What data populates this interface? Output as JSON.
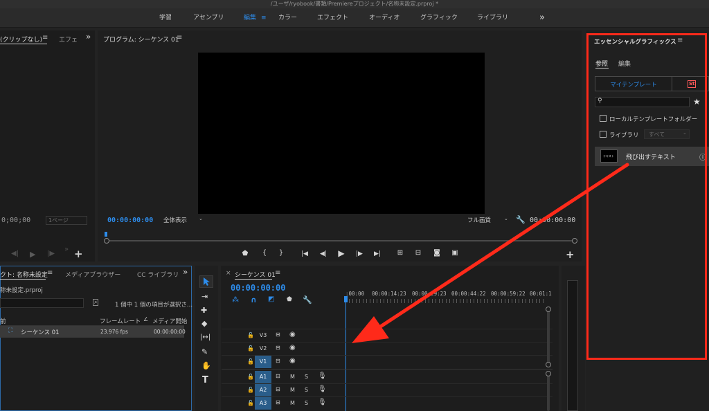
{
  "window": {
    "title": "/ユーザ/ryobook/書類/Premiereプロジェクト/名称未設定.prproj *"
  },
  "workspaces": {
    "items": [
      "学習",
      "アセンブリ",
      "編集",
      "カラー",
      "エフェクト",
      "オーディオ",
      "グラフィック",
      "ライブラリ"
    ],
    "active": "編集",
    "menu_icon": "≡",
    "more": "»"
  },
  "source_panel": {
    "tab_label": "(クリップなし)",
    "menu": "≡",
    "tab2": "エフェ",
    "more": "»",
    "timecode": "0;00;00",
    "page_select": "1ページ"
  },
  "program_monitor": {
    "title": "プログラム: シーケンス 01",
    "menu": "≡",
    "timecode_left": "00:00:00:00",
    "zoom": "全体表示",
    "quality": "フル画質",
    "timecode_right": "00:00:00:00"
  },
  "project_panel": {
    "tab1": "クト: 名称未設定",
    "menu": "≡",
    "tab2": "メディアブラウザー",
    "tab3": "CC ライブラリ",
    "file": "称未設定.prproj",
    "selection_info": "1 個中 1 個の項目が選択さ...",
    "columns": [
      "前",
      "フレームレート",
      "メディア開始"
    ],
    "rows": [
      {
        "name": "シーケンス 01",
        "fps": "23.976 fps",
        "start": "00:00:00:00"
      }
    ]
  },
  "timeline": {
    "title": "シーケンス 01",
    "menu": "≡",
    "close": "×",
    "timecode": "00:00:00:00",
    "ruler": [
      ":00:00",
      "00:00:14:23",
      "00:00:29:23",
      "00:00:44:22",
      "00:00:59:22",
      "00:01:1"
    ],
    "video_tracks": [
      "V3",
      "V2",
      "V1"
    ],
    "audio_tracks": [
      "A1",
      "A2",
      "A3"
    ],
    "m": "M",
    "s": "S"
  },
  "essential_graphics": {
    "title": "エッセンシャルグラフィックス",
    "menu": "≡",
    "tabs": [
      "参照",
      "編集"
    ],
    "subtabs": [
      "マイテンプレート",
      "St"
    ],
    "search_placeholder": "",
    "local_checkbox": "ローカルテンプレートフォルダー",
    "library_checkbox": "ライブラリ",
    "library_select": "すべて",
    "template_item": "飛び出すテキスト",
    "thumb_text": "テキスト"
  },
  "colors": {
    "accent_blue": "#2d8ceb",
    "annotation_red": "#ff2a1a",
    "track_on": "#2a5d8a"
  }
}
